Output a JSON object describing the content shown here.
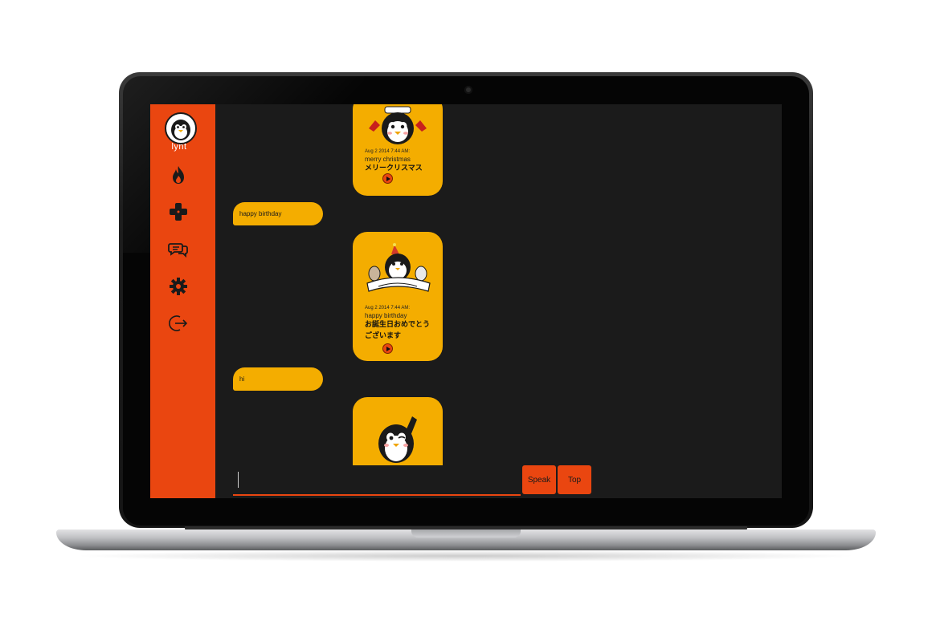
{
  "app": {
    "logo_text": "lynt"
  },
  "sidebar": {
    "items": [
      {
        "name": "hot",
        "icon": "flame-icon"
      },
      {
        "name": "games",
        "icon": "gamepad-icon"
      },
      {
        "name": "chat",
        "icon": "chat-bubbles-icon"
      },
      {
        "name": "settings",
        "icon": "gear-icon"
      },
      {
        "name": "logout",
        "icon": "logout-icon"
      }
    ]
  },
  "messages": [
    {
      "type": "card",
      "stamp": "penguin-santa-stamp",
      "timestamp": "Aug 2 2014 7:44 AM:",
      "text": "merry christmas",
      "translation": "メリークリスマス"
    },
    {
      "type": "sent",
      "text": "happy birthday"
    },
    {
      "type": "card",
      "stamp": "penguin-birthday-stamp",
      "timestamp": "Aug 2 2014 7:44 AM:",
      "text": "happy birthday",
      "translation": "お誕生日おめでとうございます"
    },
    {
      "type": "sent",
      "text": "hi"
    },
    {
      "type": "card",
      "stamp": "penguin-waving-stamp"
    }
  ],
  "composer": {
    "input_value": "",
    "speak_label": "Speak",
    "top_label": "Top"
  },
  "colors": {
    "accent": "#ea4610",
    "bubble": "#f4ad00",
    "background": "#1b1b1b"
  }
}
